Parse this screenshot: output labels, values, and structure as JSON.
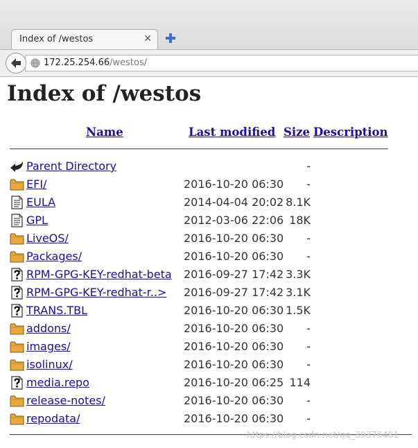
{
  "browser": {
    "tab_title": "Index of /westos",
    "tab_close": "✕",
    "url_host": "172.25.254.66",
    "url_path": "/westos/"
  },
  "page": {
    "title": "Index of /westos",
    "headers": {
      "name": "Name",
      "last_modified": "Last modified",
      "size": "Size",
      "description": "Description"
    },
    "entries": [
      {
        "name": "Parent Directory",
        "modified": "",
        "size": "-",
        "icon": "back-arrow-icon"
      },
      {
        "name": "EFI/",
        "modified": "2016-10-20 06:30",
        "size": "-",
        "icon": "folder-icon"
      },
      {
        "name": "EULA",
        "modified": "2014-04-04 20:02",
        "size": "8.1K",
        "icon": "text-file-icon"
      },
      {
        "name": "GPL",
        "modified": "2012-03-06 22:06",
        "size": "18K",
        "icon": "text-file-icon"
      },
      {
        "name": "LiveOS/",
        "modified": "2016-10-20 06:30",
        "size": "-",
        "icon": "folder-icon"
      },
      {
        "name": "Packages/",
        "modified": "2016-10-20 06:30",
        "size": "-",
        "icon": "folder-icon"
      },
      {
        "name": "RPM-GPG-KEY-redhat-beta",
        "modified": "2016-09-27 17:42",
        "size": "3.3K",
        "icon": "unknown-file-icon"
      },
      {
        "name": "RPM-GPG-KEY-redhat-r..>",
        "modified": "2016-09-27 17:42",
        "size": "3.1K",
        "icon": "unknown-file-icon"
      },
      {
        "name": "TRANS.TBL",
        "modified": "2016-10-20 06:30",
        "size": "1.5K",
        "icon": "unknown-file-icon"
      },
      {
        "name": "addons/",
        "modified": "2016-10-20 06:30",
        "size": "-",
        "icon": "folder-icon"
      },
      {
        "name": "images/",
        "modified": "2016-10-20 06:30",
        "size": "-",
        "icon": "folder-icon"
      },
      {
        "name": "isolinux/",
        "modified": "2016-10-20 06:30",
        "size": "-",
        "icon": "folder-icon"
      },
      {
        "name": "media.repo",
        "modified": "2016-10-20 06:25",
        "size": "114",
        "icon": "unknown-file-icon"
      },
      {
        "name": "release-notes/",
        "modified": "2016-10-20 06:30",
        "size": "-",
        "icon": "folder-icon"
      },
      {
        "name": "repodata/",
        "modified": "2016-10-20 06:30",
        "size": "-",
        "icon": "folder-icon"
      }
    ]
  },
  "watermark": "https://blog.csdn.net/qq_39376481",
  "colors": {
    "link": "#1a0dab",
    "folder": "#e8a93a"
  }
}
